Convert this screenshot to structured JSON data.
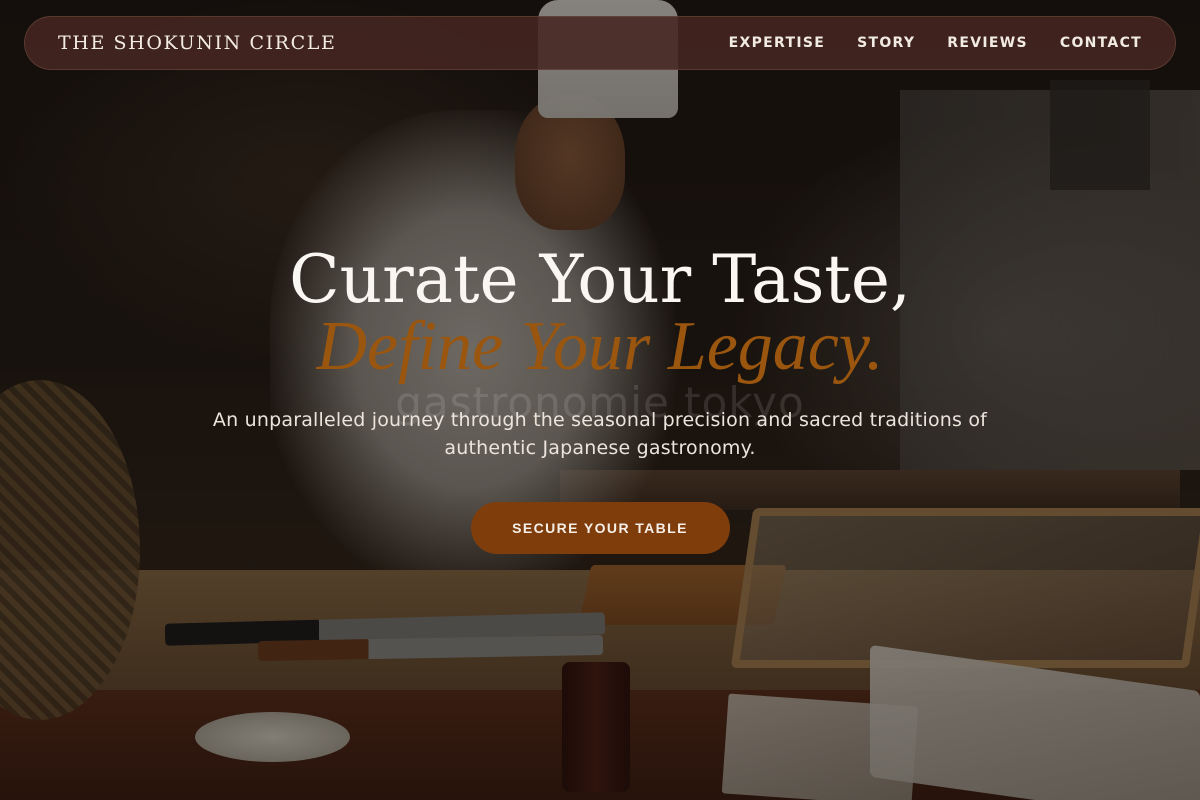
{
  "header": {
    "brand": "THE SHOKUNIN CIRCLE",
    "nav": [
      {
        "label": "EXPERTISE"
      },
      {
        "label": "STORY"
      },
      {
        "label": "REVIEWS"
      },
      {
        "label": "CONTACT"
      }
    ]
  },
  "hero": {
    "headline": "Curate Your Taste,",
    "subheadline": "Define Your Legacy.",
    "watermark": "gastronomie tokyo",
    "tagline": "An unparalleled journey through the seasonal precision and sacred traditions of authentic Japanese gastronomy.",
    "cta_label": "SECURE YOUR TABLE"
  },
  "colors": {
    "nav_bg": "#46261f",
    "accent": "#9a560f",
    "cta_bg": "#7f3d0c",
    "text_light": "#faf7f2"
  }
}
